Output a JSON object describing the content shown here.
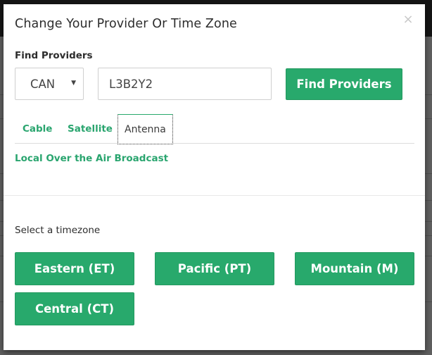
{
  "modal": {
    "title": "Change Your Provider Or Time Zone",
    "close_icon": "×"
  },
  "find_providers": {
    "label": "Find Providers",
    "country_select": {
      "selected": "CAN",
      "caret": "▼"
    },
    "postal_code": {
      "value": "L3B2Y2",
      "placeholder": ""
    },
    "button_label": "Find Providers"
  },
  "tabs": [
    {
      "label": "Cable",
      "active": false
    },
    {
      "label": "Satellite",
      "active": false
    },
    {
      "label": "Antenna",
      "active": true
    }
  ],
  "tab_content": {
    "providers": [
      "Local Over the Air Broadcast"
    ]
  },
  "timezone": {
    "label": "Select a timezone",
    "options": [
      {
        "label": "Eastern (ET)"
      },
      {
        "label": "Pacific (PT)"
      },
      {
        "label": "Mountain (M)"
      },
      {
        "label": "Central (CT)"
      }
    ]
  },
  "colors": {
    "accent": "#28a96c",
    "link": "#2aa56f",
    "text": "#2d2d2d"
  }
}
